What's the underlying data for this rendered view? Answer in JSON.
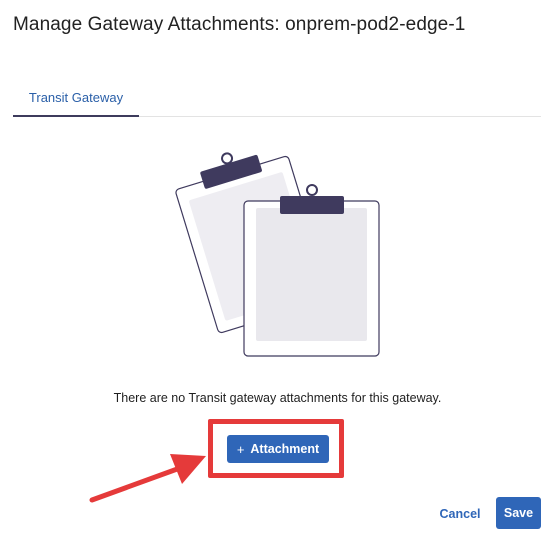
{
  "dialog": {
    "title": "Manage Gateway Attachments: onprem-pod2-edge-1"
  },
  "tabs": [
    {
      "label": "Transit Gateway",
      "active": true
    }
  ],
  "empty_state": {
    "illustration": "clipboards-icon",
    "message": "There are no Transit gateway attachments for this gateway."
  },
  "actions": {
    "add_attachment_icon": "+",
    "add_attachment_label": "Attachment",
    "cancel_label": "Cancel",
    "save_label": "Save"
  },
  "colors": {
    "primary": "#2f66b8",
    "tab_underline": "#3d3b5c",
    "highlight": "#e53a3a",
    "clip": "#3f3a5e"
  }
}
